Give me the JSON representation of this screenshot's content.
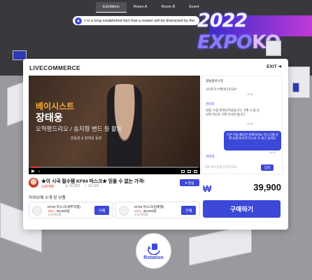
{
  "nav": {
    "items": [
      "Exhibition",
      "Room A",
      "Room B",
      "Event"
    ]
  },
  "notice": {
    "text": "t is a long established fact that a reader will be distracted by the"
  },
  "background": {
    "sign_year": "2022",
    "sign_word": "EXPO",
    "sign_tail": "KO"
  },
  "modal": {
    "title": "LIVECOMMERCE",
    "exit": "EXIT"
  },
  "video": {
    "overlay_line1": "베이시스트",
    "overlay_line2": "장태웅",
    "overlay_line3": "오혁평드리오 / 송지형 밴드 등 활동",
    "overlay_line4": "장동훈 & 장태웅 등장",
    "progress_pct": 5
  },
  "product": {
    "title": "★이 시국 필수템 KF94 마스크★ 믿을 수 없는 가격!",
    "seller": "쇼핑계정",
    "views": "◎ 10,223",
    "likes": "♡ 10,223",
    "alarm_label": "♥ 알림",
    "list_heading": "라이브에 소개 된 상품",
    "items": [
      {
        "name": "KF94 마스크(새부직형)",
        "discount": "10%",
        "price": "39,900원",
        "seller": "쇼핑계정몰",
        "button": "구매"
      },
      {
        "name": "KF94 마스크(입체형)",
        "discount": "10%",
        "price": "39,900원",
        "seller": "쇼핑계정몰",
        "button": "구매"
      }
    ]
  },
  "chat": {
    "messages": [
      {
        "user": "광남랑아스킨",
        "text": "",
        "time": ""
      },
      {
        "user": "",
        "text": "사이즈가 어떻게 되나요?",
        "time": "18:30"
      },
      {
        "user": "관리자",
        "text": "대형, 소형 준비되어있습니다. 구매 시 옵 선 선택 하신후 구매 하시면 됩니다",
        "time": "18:30"
      },
      {
        "user": "",
        "text": "다른 한술 빠로한 판매자마57 마스크를 순 에 10분에 비치 다시사 지 세고 살까요.",
        "time": "18:30"
      },
      {
        "user": "관리자",
        "text": "",
        "time": ""
      }
    ],
    "input_placeholder": "대화 메시지를 입력하세요",
    "send_label": "입력"
  },
  "purchase": {
    "currency": "₩",
    "price": "39,900",
    "buy_label": "구매하기"
  },
  "rotation": {
    "label": "Rotation"
  },
  "colors": {
    "accent": "#3b48d8",
    "sale": "#e03a3a"
  }
}
